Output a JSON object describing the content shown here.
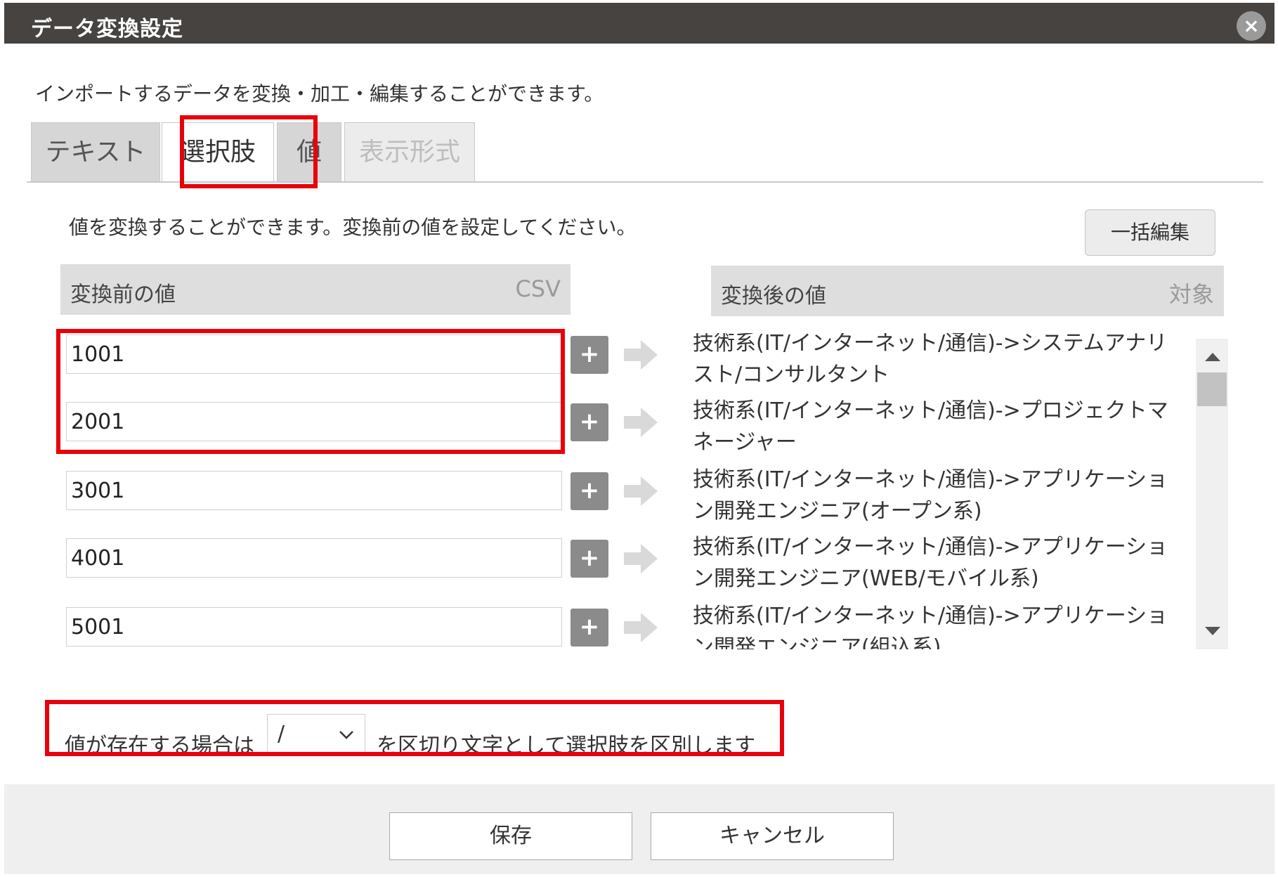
{
  "dialog": {
    "title": "データ変換設定",
    "close_label": "×",
    "description": "インポートするデータを変換・加工・編集することができます。"
  },
  "tabs": [
    {
      "label": "テキスト",
      "state": "normal"
    },
    {
      "label": "選択肢",
      "state": "active"
    },
    {
      "label": "値",
      "state": "normal"
    },
    {
      "label": "表示形式",
      "state": "disabled"
    }
  ],
  "panel": {
    "description": "値を変換することができます。変換前の値を設定してください。",
    "bulk_edit_label": "一括編集",
    "before_header": {
      "label": "変換前の値",
      "tag": "CSV"
    },
    "after_header": {
      "label": "変換後の値",
      "tag": "対象"
    },
    "plus_label": "+",
    "rows": [
      {
        "value": "1001",
        "target": "技術系(IT/インターネット/通信)->システムアナリスト/コンサルタント"
      },
      {
        "value": "2001",
        "target": "技術系(IT/インターネット/通信)->プロジェクトマネージャー"
      },
      {
        "value": "3001",
        "target": "技術系(IT/インターネット/通信)->アプリケーション開発エンジニア(オープン系)"
      },
      {
        "value": "4001",
        "target": "技術系(IT/インターネット/通信)->アプリケーション開発エンジニア(WEB/モバイル系)"
      },
      {
        "value": "5001",
        "target": "技術系(IT/インターネット/通信)->アプリケーション開発エンジニア(組込系)"
      }
    ]
  },
  "separator": {
    "before_text": "値が存在する場合は",
    "selected": "/",
    "after_text": "を区切り文字として選択肢を区別します"
  },
  "footer": {
    "save_label": "保存",
    "cancel_label": "キャンセル"
  },
  "colors": {
    "titlebar": "#474340",
    "highlight": "#e8000b",
    "plus_button": "#8b8b8b"
  }
}
